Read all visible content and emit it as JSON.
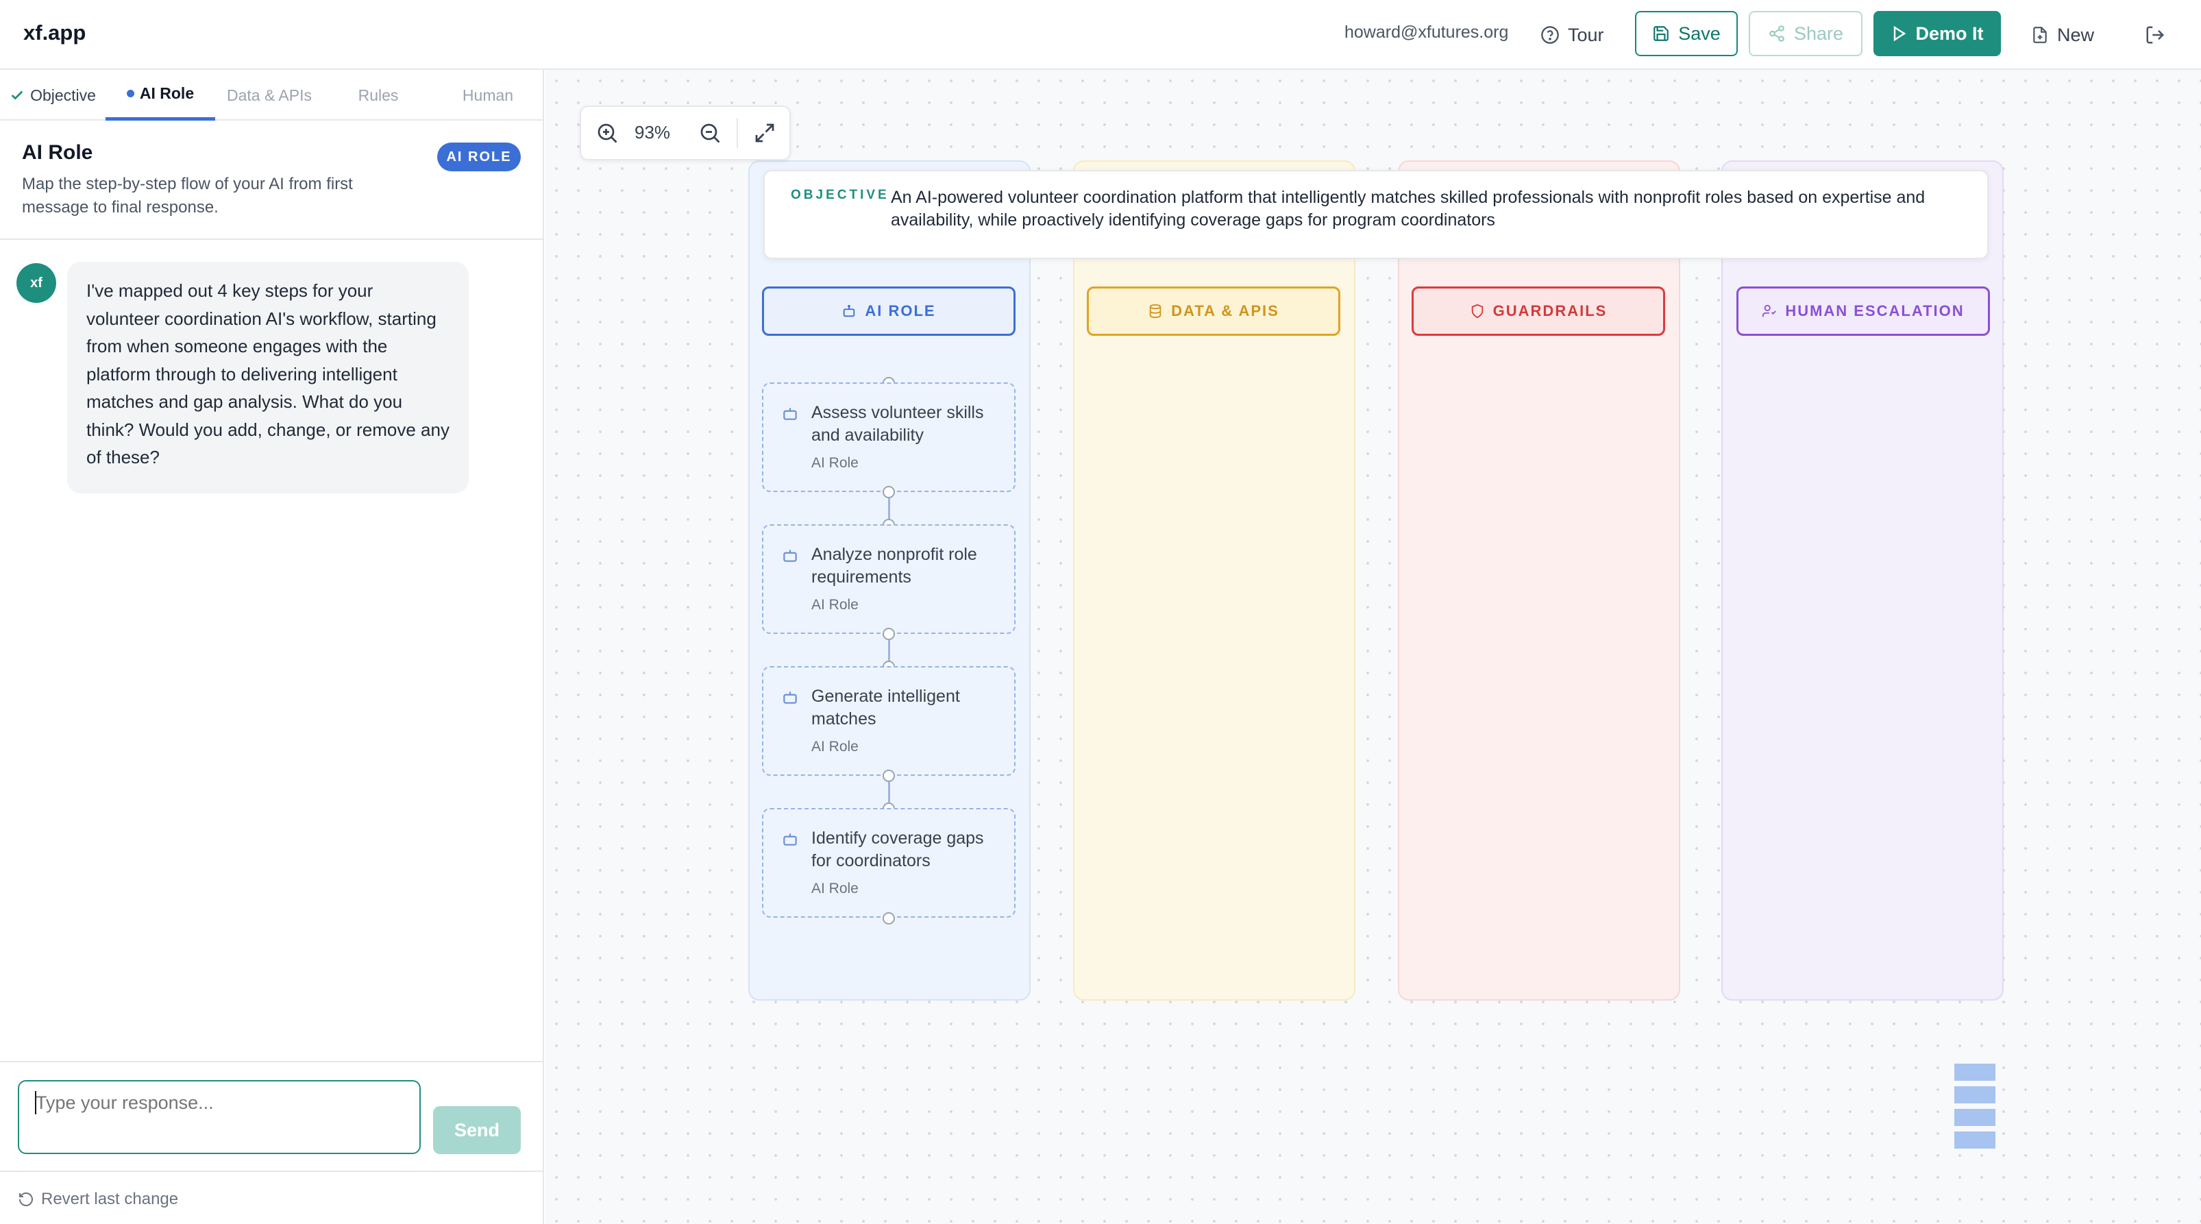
{
  "app": {
    "title": "xf.app"
  },
  "header": {
    "email": "howard@xfutures.org",
    "tour_label": "Tour",
    "save_label": "Save",
    "share_label": "Share",
    "demo_label": "Demo It",
    "new_label": "New"
  },
  "tabs": [
    {
      "label": "Objective",
      "state": "done"
    },
    {
      "label": "AI Role",
      "state": "active"
    },
    {
      "label": "Data & APIs",
      "state": "pending"
    },
    {
      "label": "Rules",
      "state": "pending"
    },
    {
      "label": "Human",
      "state": "pending"
    }
  ],
  "section": {
    "title": "AI Role",
    "badge": "AI ROLE",
    "description": "Map the step-by-step flow of your AI from first message to final response."
  },
  "chat": {
    "avatar": "xf",
    "message": "I've mapped out 4 key steps for your volunteer coordination AI's workflow, starting from when someone engages with the platform through to delivering intelligent matches and gap analysis. What do you think? Would you add, change, or remove any of these?"
  },
  "input": {
    "placeholder": "Type your response...",
    "value": "",
    "send_label": "Send"
  },
  "revert_label": "Revert last change",
  "canvas": {
    "zoom": "93%",
    "objective_label": "OBJECTIVE",
    "objective_text": "An AI-powered volunteer coordination platform that intelligently matches skilled professionals with nonprofit roles based on expertise and availability, while proactively identifying coverage gaps for program coordinators",
    "columns": [
      {
        "label": "AI ROLE",
        "icon": "robot-icon",
        "color": "#3b6fd6"
      },
      {
        "label": "DATA & APIS",
        "icon": "database-icon",
        "color": "#e0a423"
      },
      {
        "label": "GUARDRAILS",
        "icon": "shield-icon",
        "color": "#dc3b3b"
      },
      {
        "label": "HUMAN ESCALATION",
        "icon": "user-check-icon",
        "color": "#8a4fd6"
      }
    ],
    "steps": [
      {
        "title": "Assess volunteer skills and availability",
        "type": "AI Role"
      },
      {
        "title": "Analyze nonprofit role requirements",
        "type": "AI Role"
      },
      {
        "title": "Generate intelligent matches",
        "type": "AI Role"
      },
      {
        "title": "Identify coverage gaps for coordinators",
        "type": "AI Role"
      }
    ]
  },
  "colors": {
    "brand": "#1e8f7e",
    "ai_role": "#3b6fd6",
    "data": "#e0a423",
    "guardrails": "#dc3b3b",
    "human": "#8a4fd6"
  }
}
